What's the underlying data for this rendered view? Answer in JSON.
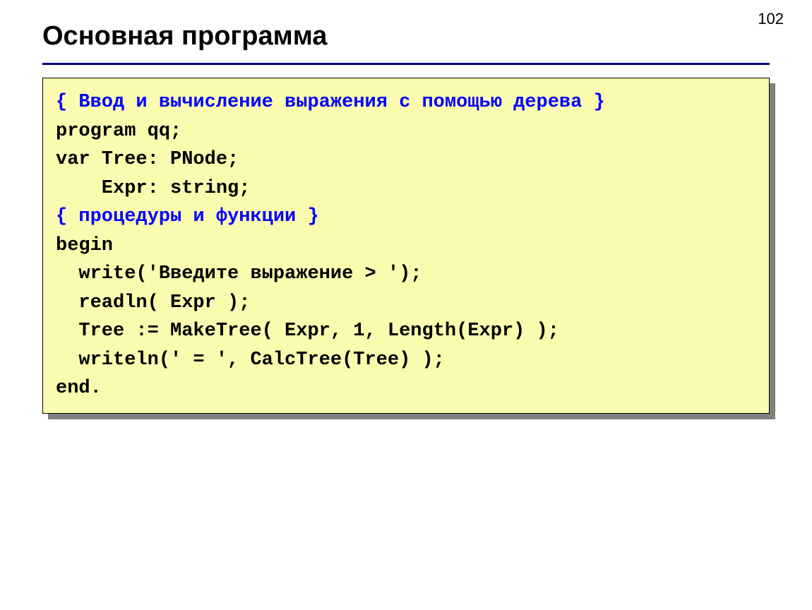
{
  "page_number": "102",
  "title": "Основная программа",
  "code": {
    "comment1": "{ Ввод и вычисление выражения с помощью дерева }",
    "line_program": "program qq;",
    "line_var1": "var Tree: PNode;",
    "line_var2": "    Expr: string;",
    "comment2": "{ процедуры и функции }",
    "line_begin": "begin",
    "line_write": "  write('Введите выражение > ');",
    "line_readln": "  readln( Expr );",
    "line_tree": "  Tree := MakeTree( Expr, 1, Length(Expr) );",
    "line_writeln": "  writeln(' = ', CalcTree(Tree) );",
    "line_end": "end."
  }
}
